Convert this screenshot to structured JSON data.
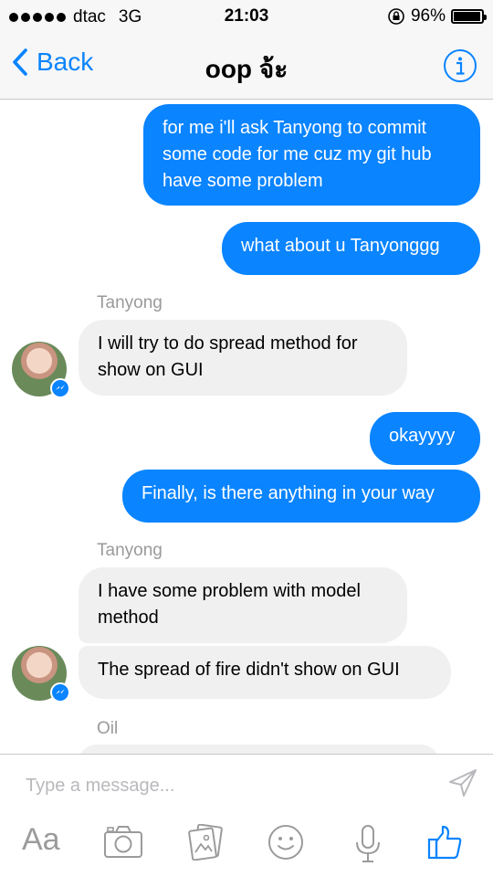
{
  "status_bar": {
    "carrier": "dtac",
    "network": "3G",
    "time": "21:03",
    "battery_percent": "96%",
    "battery_level": 0.96
  },
  "nav": {
    "back_label": "Back",
    "title": "oop จ้ะ"
  },
  "messages": [
    {
      "type": "out",
      "text": "for me i'll ask Tanyong to commit some code for me cuz my git hub have some problem"
    },
    {
      "type": "out",
      "text": "what about u Tanyonggg"
    },
    {
      "type": "sender",
      "text": "Tanyong"
    },
    {
      "type": "in",
      "text": "I will try to do spread method for show on GUI"
    },
    {
      "type": "out",
      "text": "okayyyy"
    },
    {
      "type": "out",
      "text": "Finally, is there anything in your way"
    },
    {
      "type": "sender",
      "text": "Tanyong"
    },
    {
      "type": "in",
      "text": "I have some problem with model method"
    },
    {
      "type": "in",
      "text": "The spread of fire didn't show on GUI"
    },
    {
      "type": "sender",
      "text": "Oil"
    }
  ],
  "composer": {
    "placeholder": "Type a message...",
    "aa_label": "Aa"
  },
  "colors": {
    "accent": "#0a84ff",
    "incoming_bubble": "#f0f0f0",
    "icon_gray": "#9b9b9b"
  },
  "icons": [
    "back-chevron-icon",
    "info-icon",
    "send-icon",
    "text-format-icon",
    "camera-icon",
    "photo-gallery-icon",
    "emoji-icon",
    "microphone-icon",
    "like-thumbs-up-icon"
  ]
}
